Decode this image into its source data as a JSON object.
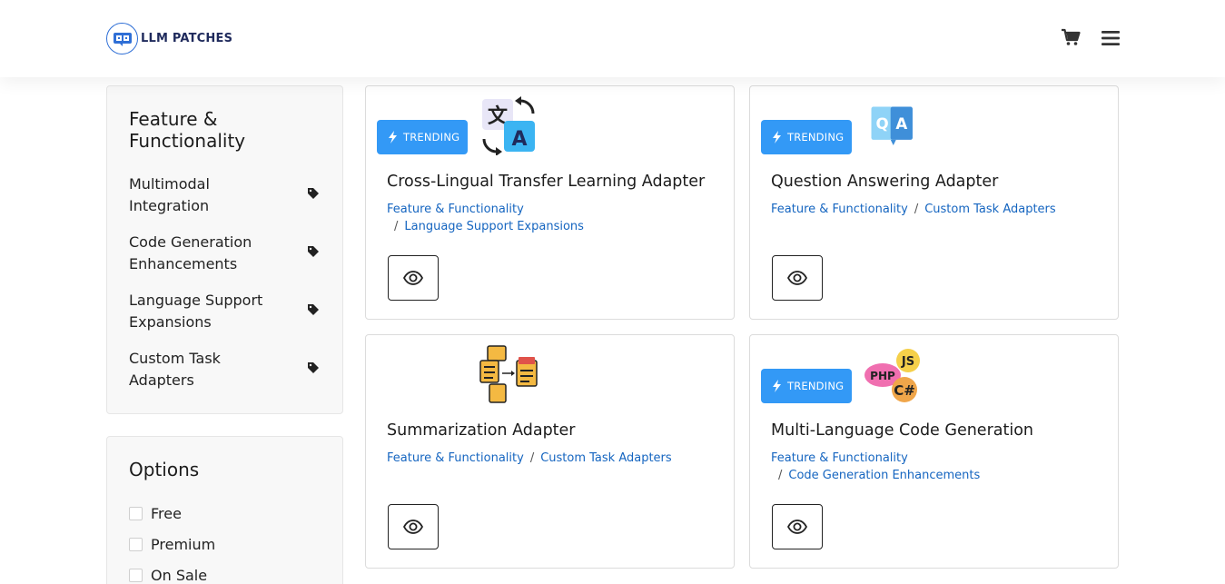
{
  "header": {
    "logo_text": "LLM PATCHES",
    "icons": {
      "logo": "llm-patches-logo-icon",
      "cart": "shopping-cart-icon",
      "menu": "hamburger-menu-icon"
    }
  },
  "sidebar": {
    "categories_title": "Feature & Functionality",
    "categories": [
      {
        "label": "Multimodal Integration",
        "icon": "tag-icon"
      },
      {
        "label": "Code Generation Enhancements",
        "icon": "tag-icon"
      },
      {
        "label": "Language Support Expansions",
        "icon": "tag-icon"
      },
      {
        "label": "Custom Task Adapters",
        "icon": "tag-icon"
      }
    ],
    "options_title": "Options",
    "options": [
      {
        "label": "Free",
        "checked": false
      },
      {
        "label": "Premium",
        "checked": false
      },
      {
        "label": "On Sale",
        "checked": false
      }
    ]
  },
  "products": [
    {
      "title": "Cross-Lingual Transfer Learning Adapter",
      "badge": "TRENDING",
      "crumbs": [
        "Feature & Functionality",
        "Language Support Expansions"
      ],
      "icon": "translate-icon"
    },
    {
      "title": "Question Answering Adapter",
      "badge": "TRENDING",
      "crumbs": [
        "Feature & Functionality",
        "Custom Task Adapters"
      ],
      "icon": "qa-icon"
    },
    {
      "title": "Summarization Adapter",
      "badge": "",
      "crumbs": [
        "Feature & Functionality",
        "Custom Task Adapters"
      ],
      "icon": "documents-icon"
    },
    {
      "title": "Multi-Language Code Generation",
      "badge": "TRENDING",
      "crumbs": [
        "Feature & Functionality",
        "Code Generation Enhancements"
      ],
      "icon": "code-languages-icon"
    }
  ],
  "colors": {
    "badge": "#3399f6",
    "link": "#1565c0",
    "panel": "#f8f8f8"
  }
}
